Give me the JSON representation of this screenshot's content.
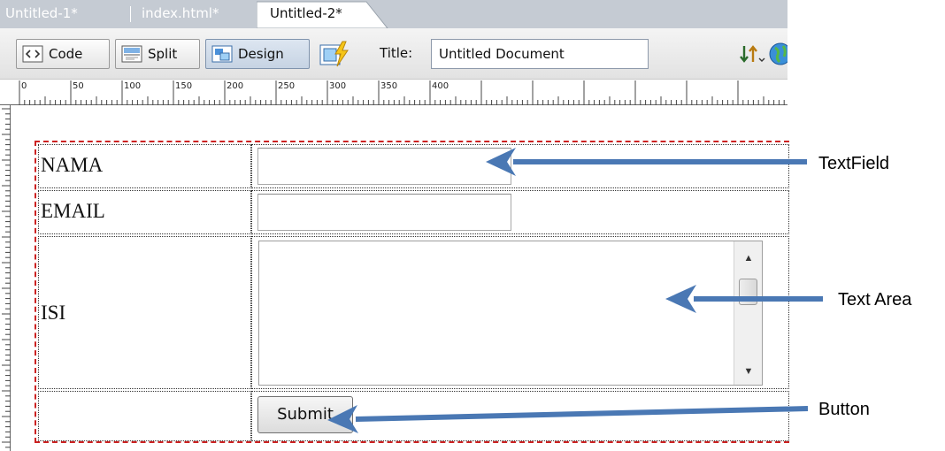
{
  "tabs": [
    {
      "label": "Untitled-1*",
      "active": false
    },
    {
      "label": "index.html*",
      "active": false
    },
    {
      "label": "Untitled-2*",
      "active": true
    }
  ],
  "toolbar": {
    "views": [
      {
        "label": "Code",
        "icon": "code-view-icon",
        "pressed": false
      },
      {
        "label": "Split",
        "icon": "split-view-icon",
        "pressed": false
      },
      {
        "label": "Design",
        "icon": "design-view-icon",
        "pressed": true
      }
    ],
    "title_label": "Title:",
    "title_value": "Untitled Document"
  },
  "ruler": {
    "labels": [
      "0",
      "50",
      "100",
      "150",
      "200",
      "250",
      "300",
      "350",
      "400"
    ]
  },
  "form": {
    "rows": [
      {
        "label": "NAMA",
        "control": "textfield"
      },
      {
        "label": "EMAIL",
        "control": "textfield"
      },
      {
        "label": "ISI",
        "control": "textarea"
      },
      {
        "label": "",
        "control": "button"
      }
    ],
    "submit_label": "Submit"
  },
  "annotations": {
    "textfield": "TextField",
    "textarea": "Text Area",
    "button": "Button"
  },
  "colors": {
    "arrow": "#4a78b4",
    "table_border": "#cc2222",
    "tab_bar": "#c5cbd3"
  }
}
